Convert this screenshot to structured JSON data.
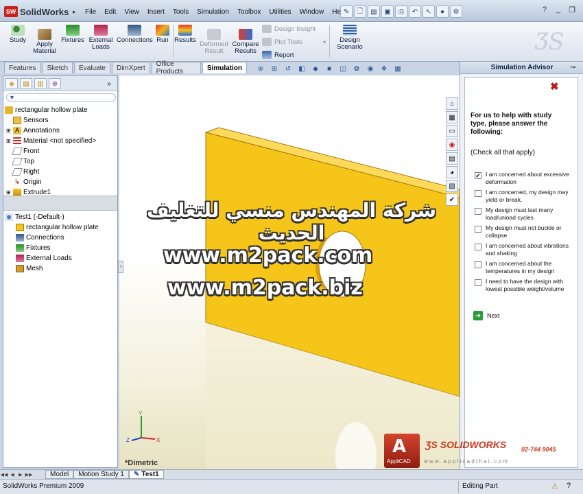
{
  "app": {
    "name": "SolidWorks",
    "logo_badge": "SW"
  },
  "menu": [
    "File",
    "Edit",
    "View",
    "Insert",
    "Tools",
    "Simulation",
    "Toolbox",
    "Utilities",
    "Window",
    "Help"
  ],
  "ribbon": {
    "study": "Study",
    "apply_material": "Apply Material",
    "fixtures": "Fixtures",
    "external_loads": "External Loads",
    "connections": "Connections",
    "run": "Run",
    "results": "Results",
    "deformed_result": "Deformed Result",
    "compare_results": "Compare Results",
    "design_insight": "Design Insight",
    "plot_tools": "Plot Tools",
    "report": "Report",
    "design_scenario": "Design Scenario"
  },
  "tabs": [
    "Features",
    "Sketch",
    "Evaluate",
    "DimXpert",
    "Office Products",
    "Simulation"
  ],
  "tree": {
    "root": "rectangular hollow plate",
    "items": [
      "Sensors",
      "Annotations",
      "Material <not specified>",
      "Front",
      "Top",
      "Right",
      "Origin",
      "Extrude1"
    ]
  },
  "study_tree": {
    "root": "Test1 (-Default-)",
    "items": [
      "rectangular hollow plate",
      "Connections",
      "Fixtures",
      "External Loads",
      "Mesh"
    ]
  },
  "viewport": {
    "view_label": "*Dimetric"
  },
  "advisor": {
    "title": "Simulation Advisor",
    "question": "For us to help with study type, please answer the following:",
    "note": "(Check all that apply)",
    "options": [
      {
        "label": "I am concerned about excessive deformation",
        "checked": true
      },
      {
        "label": "I am concerned, my design may yield or break.",
        "checked": false
      },
      {
        "label": "My design must last many load/unload cycles",
        "checked": false
      },
      {
        "label": "My design must not buckle or collapse",
        "checked": false
      },
      {
        "label": "I am concerned about vibrations and shaking",
        "checked": false
      },
      {
        "label": "I am concerned about the temperatures in my design",
        "checked": false
      },
      {
        "label": "I need to have the design with lowest possible weight/volume",
        "checked": false
      }
    ],
    "next": "Next"
  },
  "bottom_tabs": [
    "Model",
    "Motion Study 1",
    "Test1"
  ],
  "status": {
    "left": "SolidWorks Premium 2009",
    "right": "Editing Part"
  },
  "watermark": {
    "arabic": "شركة المهندس منسي للتغليف الحديث",
    "url1": "www.m2pack.com",
    "url2": "www.m2pack.biz",
    "brand": "SOLIDWORKS",
    "phone": "02-744 9045",
    "reseller": "AppliCAD",
    "website": "w w w . a p p l i c a d t h a i . c o m"
  },
  "colors": {
    "part_face": "#f6c51a",
    "part_top": "#ffd95a",
    "part_side": "#e0a80c",
    "accent_red": "#c01616"
  }
}
